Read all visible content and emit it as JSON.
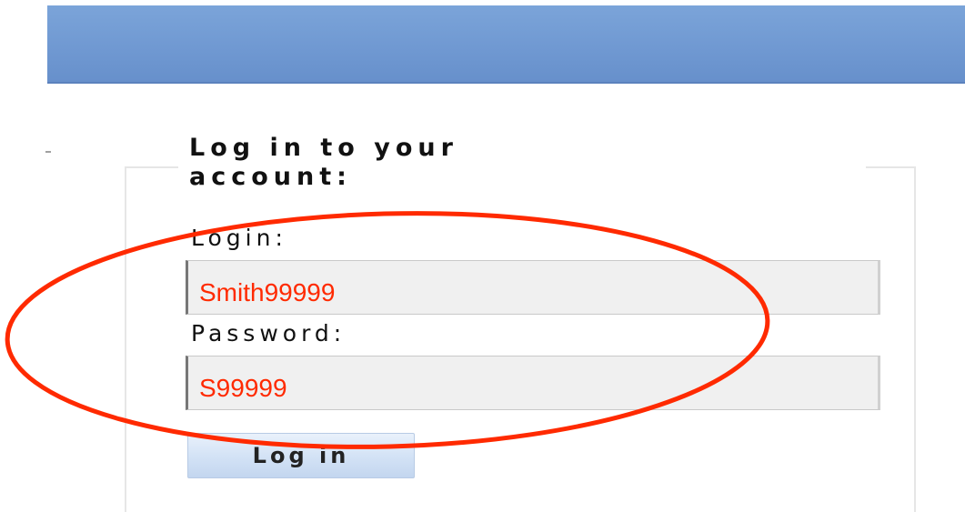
{
  "form": {
    "legend": "Log in to your\naccount:",
    "login_label": "Login:",
    "login_value": "Smith99999",
    "password_label": "Password:",
    "password_value": "S99999",
    "submit_label": "Log in"
  },
  "colors": {
    "header": "#7099d2",
    "annotation": "#ff2a00",
    "input_text": "#ff2a00"
  },
  "annotation": {
    "shape": "ellipse",
    "highlights": [
      "login-input",
      "password-input"
    ]
  }
}
